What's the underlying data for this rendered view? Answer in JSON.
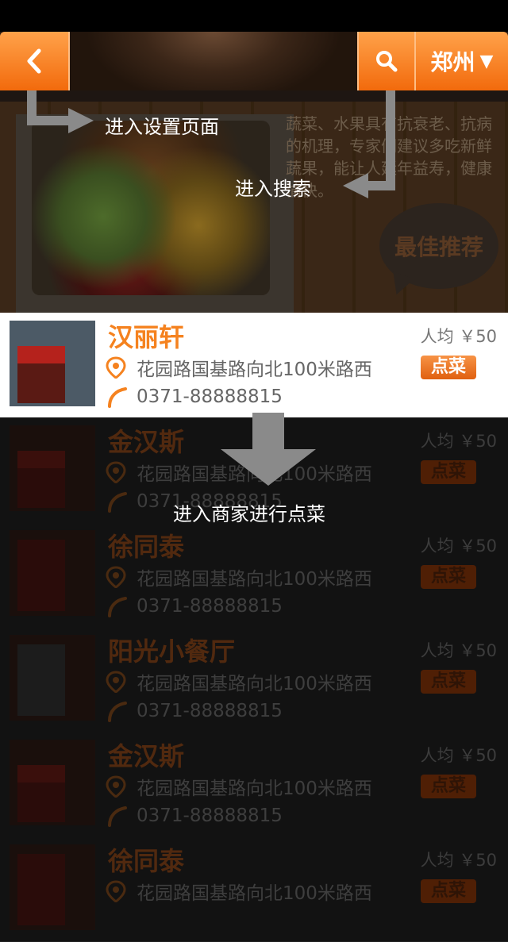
{
  "nav": {
    "back_icon": "chevron-left-icon",
    "search_icon": "search-icon",
    "city": "郑州",
    "city_arrow": "▼",
    "accent": "#f5821f"
  },
  "banner": {
    "text": "蔬菜、水果具有抗衰老、抗病的机理，专家们建议多吃新鲜蔬果，能让人延年益寿，健康愉快。",
    "badge": "最佳推荐"
  },
  "tips": {
    "settings": "进入设置页面",
    "search": "进入搜索",
    "merchant": "进入商家进行点菜"
  },
  "restaurants": [
    {
      "name": "汉丽轩",
      "avg": "人均 ￥50",
      "address": "花园路国基路向北100米路西",
      "phone": "0371-88888815",
      "order": "点菜"
    },
    {
      "name": "金汉斯",
      "avg": "人均 ￥50",
      "address": "花园路国基路向北100米路西",
      "phone": "0371-88888815",
      "order": "点菜"
    },
    {
      "name": "徐同泰",
      "avg": "人均 ￥50",
      "address": "花园路国基路向北100米路西",
      "phone": "0371-88888815",
      "order": "点菜"
    },
    {
      "name": "阳光小餐厅",
      "avg": "人均 ￥50",
      "address": "花园路国基路向北100米路西",
      "phone": "0371-88888815",
      "order": "点菜"
    },
    {
      "name": "金汉斯",
      "avg": "人均 ￥50",
      "address": "花园路国基路向北100米路西",
      "phone": "0371-88888815",
      "order": "点菜"
    },
    {
      "name": "徐同泰",
      "avg": "人均 ￥50",
      "address": "花园路国基路向北100米路西",
      "phone": "0371-88888815",
      "order": "点菜"
    }
  ]
}
